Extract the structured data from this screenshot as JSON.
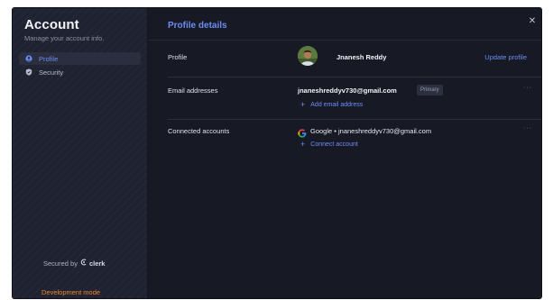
{
  "sidebar": {
    "title": "Account",
    "subtitle": "Manage your account info.",
    "items": [
      {
        "label": "Profile",
        "icon": "user-icon",
        "active": true
      },
      {
        "label": "Security",
        "icon": "shield-icon",
        "active": false
      }
    ],
    "footer": {
      "secured_by": "Secured by",
      "brand": "clerk",
      "dev_mode": "Development mode"
    }
  },
  "main": {
    "title": "Profile details",
    "profile": {
      "label": "Profile",
      "name": "Jnanesh Reddy",
      "update_link": "Update profile"
    },
    "emails": {
      "label": "Email addresses",
      "primary_email": "jnaneshreddyv730@gmail.com",
      "badge": "Primary",
      "menu": "···",
      "add_link": "Add email address"
    },
    "connected": {
      "label": "Connected accounts",
      "account": "Google • jnaneshreddyv730@gmail.com",
      "menu": "···",
      "connect_link": "Connect account"
    }
  },
  "colors": {
    "accent": "#6c8cf5",
    "background": "#171a24",
    "sidebar": "#1f2230",
    "dev_mode": "#f0852a"
  }
}
